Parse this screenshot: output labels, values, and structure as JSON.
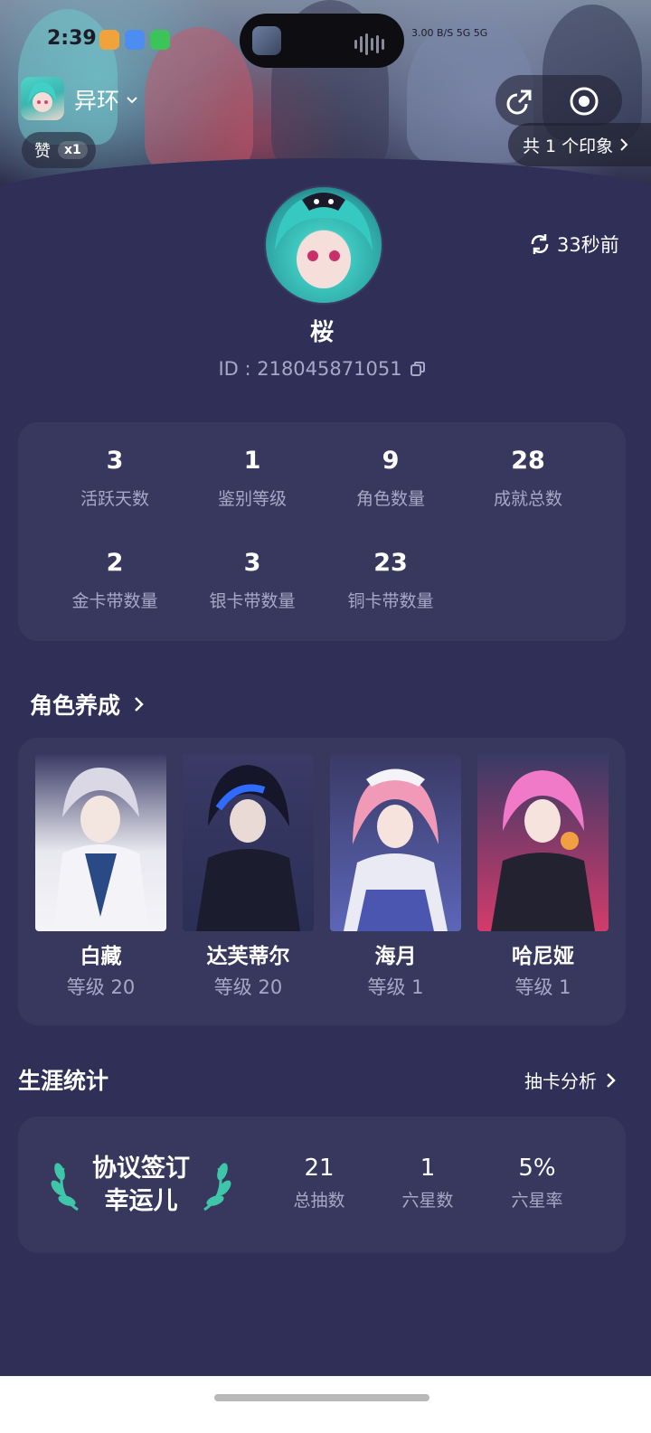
{
  "status_bar": {
    "time": "2:39",
    "right_text": "3.00 B/S  5G  5G"
  },
  "header": {
    "game_name": "异环",
    "like_label": "赞",
    "like_count": "x1",
    "impression_text": "共 1 个印象"
  },
  "profile": {
    "refresh_text": "33秒前",
    "username": "桜",
    "id_text": "ID : 218045871051"
  },
  "stats": [
    {
      "value": "3",
      "label": "活跃天数"
    },
    {
      "value": "1",
      "label": "鉴别等级"
    },
    {
      "value": "9",
      "label": "角色数量"
    },
    {
      "value": "28",
      "label": "成就总数"
    },
    {
      "value": "2",
      "label": "金卡带数量"
    },
    {
      "value": "3",
      "label": "银卡带数量"
    },
    {
      "value": "23",
      "label": "铜卡带数量"
    }
  ],
  "characters_section": {
    "title": "角色养成",
    "items": [
      {
        "name": "白藏",
        "level": "等级 20"
      },
      {
        "name": "达芙蒂尔",
        "level": "等级 20"
      },
      {
        "name": "海月",
        "level": "等级 1"
      },
      {
        "name": "哈尼娅",
        "level": "等级 1"
      }
    ]
  },
  "career_section": {
    "title": "生涯统计",
    "link": "抽卡分析",
    "badge_line1": "协议签订",
    "badge_line2": "幸运儿",
    "stats": [
      {
        "value": "21",
        "label": "总抽数"
      },
      {
        "value": "1",
        "label": "六星数"
      },
      {
        "value": "5%",
        "label": "六星率"
      }
    ]
  },
  "colors": {
    "background": "#2f2f58",
    "panel": "#38385f",
    "muted_text": "#a7a8c6",
    "laurel": "#3fc6a8"
  }
}
